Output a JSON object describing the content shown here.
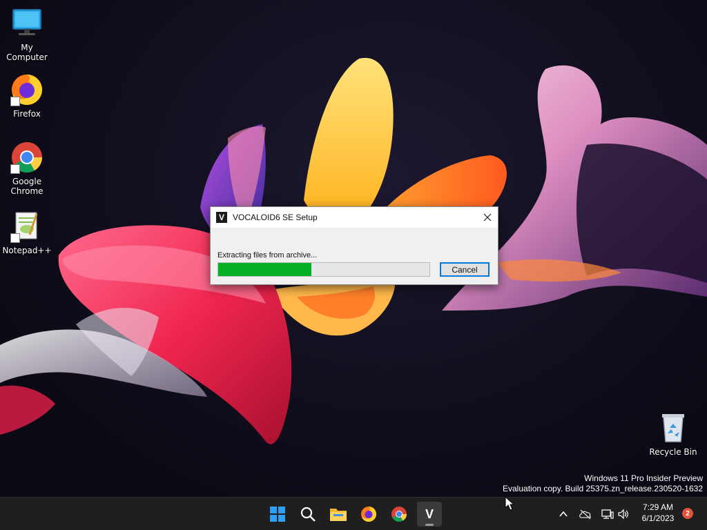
{
  "desktop": {
    "icons": [
      {
        "label": "My Computer",
        "icon": "computer-icon"
      },
      {
        "label": "Firefox",
        "icon": "firefox-icon"
      },
      {
        "label": "Google Chrome",
        "icon": "chrome-icon"
      },
      {
        "label": "Notepad++",
        "icon": "notepadpp-icon"
      },
      {
        "label": "Recycle Bin",
        "icon": "recycle-bin-icon"
      }
    ],
    "watermark": {
      "line1": "Windows 11 Pro Insider Preview",
      "line2": "Evaluation copy. Build 25375.zn_release.230520-1632"
    }
  },
  "dialog": {
    "logo_letter": "V",
    "title": "VOCALOID6 SE Setup",
    "status": "Extracting files from archive...",
    "progress_fraction": 0.44,
    "cancel_label": "Cancel"
  },
  "taskbar": {
    "pinned": [
      "start-icon",
      "search-icon",
      "file-explorer-icon",
      "firefox-icon",
      "chrome-icon",
      "vocaloid-icon"
    ],
    "vocaloid_letter": "V",
    "tray": [
      "chevron-up-icon",
      "cloud-off-icon",
      "network-icon",
      "volume-icon"
    ],
    "time": "7:29 AM",
    "date": "6/1/2023",
    "notifications": "2"
  },
  "colors": {
    "progress": "#06b025",
    "accent": "#0078d7",
    "taskbar": "#1f1f1f",
    "badge": "#e0533a"
  }
}
